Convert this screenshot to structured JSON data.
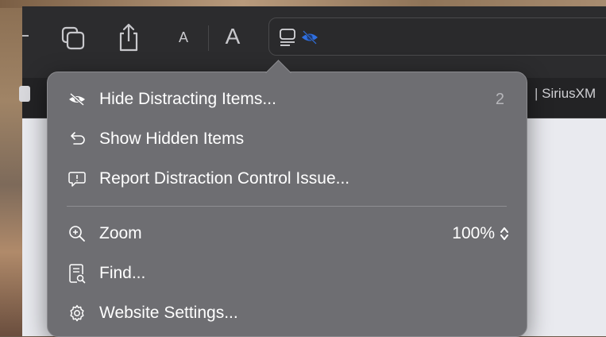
{
  "toolbar": {
    "font_small": "A",
    "font_large": "A",
    "icons": [
      "tab-overview-icon",
      "share-icon",
      "reader-icon",
      "hide-distractions-icon"
    ]
  },
  "tab": {
    "title": "| SiriusXM"
  },
  "menu": {
    "items": [
      {
        "label": "Hide Distracting Items...",
        "badge": "2",
        "icon": "eye-slash-icon"
      },
      {
        "label": "Show Hidden Items",
        "icon": "undo-arrow-icon"
      },
      {
        "label": "Report Distraction Control Issue...",
        "icon": "report-bubble-icon"
      },
      {
        "label": "Zoom",
        "value": "100%",
        "icon": "zoom-icon"
      },
      {
        "label": "Find...",
        "icon": "find-icon"
      },
      {
        "label": "Website Settings...",
        "icon": "gear-icon"
      }
    ]
  },
  "colors": {
    "menu_bg": "#6e6e72",
    "accent": "#2f6fe0"
  }
}
